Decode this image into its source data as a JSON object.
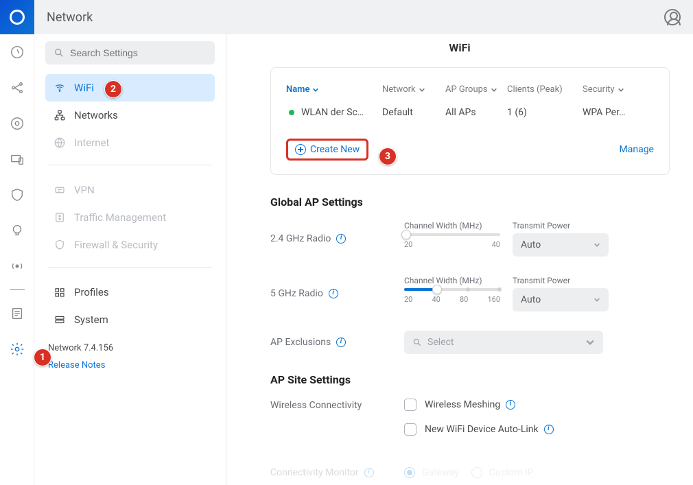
{
  "header": {
    "title": "Network"
  },
  "search": {
    "placeholder": "Search Settings"
  },
  "sidebar": {
    "items": [
      {
        "id": "wifi",
        "label": "WiFi"
      },
      {
        "id": "networks",
        "label": "Networks"
      },
      {
        "id": "internet",
        "label": "Internet"
      },
      {
        "id": "vpn",
        "label": "VPN"
      },
      {
        "id": "traffic",
        "label": "Traffic Management"
      },
      {
        "id": "firewall",
        "label": "Firewall & Security"
      },
      {
        "id": "profiles",
        "label": "Profiles"
      },
      {
        "id": "system",
        "label": "System"
      }
    ],
    "version": "Network 7.4.156",
    "release_notes": "Release Notes"
  },
  "page": {
    "title": "WiFi"
  },
  "table": {
    "headers": {
      "name": "Name",
      "network": "Network",
      "groups": "AP Groups",
      "clients": "Clients (Peak)",
      "security": "Security"
    },
    "rows": [
      {
        "name": "WLAN der Sc…",
        "network": "Default",
        "groups": "All APs",
        "clients": "1 (6)",
        "security": "WPA Per…"
      }
    ],
    "create_new": "Create New",
    "manage": "Manage"
  },
  "global_ap": {
    "title": "Global AP Settings",
    "radio24": "2.4 GHz Radio",
    "radio5": "5 GHz Radio",
    "ap_excl": "AP Exclusions",
    "channel_width": "Channel Width (MHz)",
    "transmit_power": "Transmit Power",
    "power_value": "Auto",
    "scale24": {
      "min": "20",
      "max": "40"
    },
    "scale5": {
      "v20": "20",
      "v40": "40",
      "v80": "80",
      "v160": "160"
    },
    "select_placeholder": "Select"
  },
  "site": {
    "title": "AP Site Settings",
    "wireless_conn": "Wireless Connectivity",
    "meshing": "Wireless Meshing",
    "autolink": "New WiFi Device Auto-Link",
    "conn_monitor": "Connectivity Monitor",
    "gateway": "Gateway",
    "custom_ip": "Custom IP"
  },
  "annotations": {
    "a1": "1",
    "a2": "2",
    "a3": "3"
  }
}
